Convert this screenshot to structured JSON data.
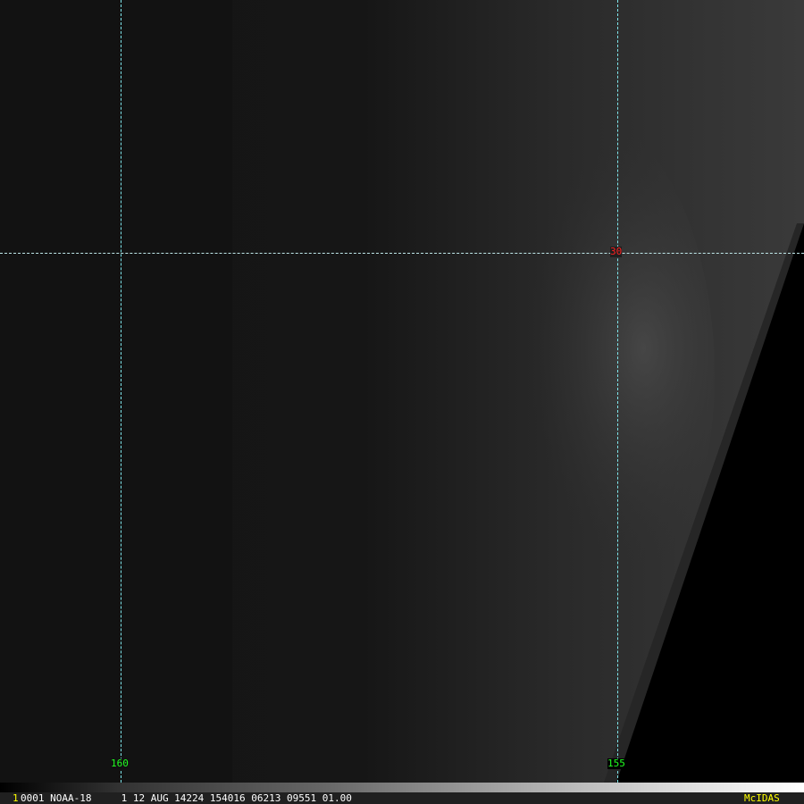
{
  "image": {
    "grid_labels": {
      "lat_30": "30",
      "lon_160": "160",
      "lon_155": "155"
    },
    "colors": {
      "grid": "#7fe8ee",
      "lat_label": "#ff2020",
      "lon_label": "#20ff20",
      "frame_label": "#ffff00"
    }
  },
  "status_bar": {
    "frame_number": "1",
    "info": "0001 NOAA-18     1 12 AUG 14224 154016 06213 09551 01.00",
    "brand": "McIDAS"
  }
}
